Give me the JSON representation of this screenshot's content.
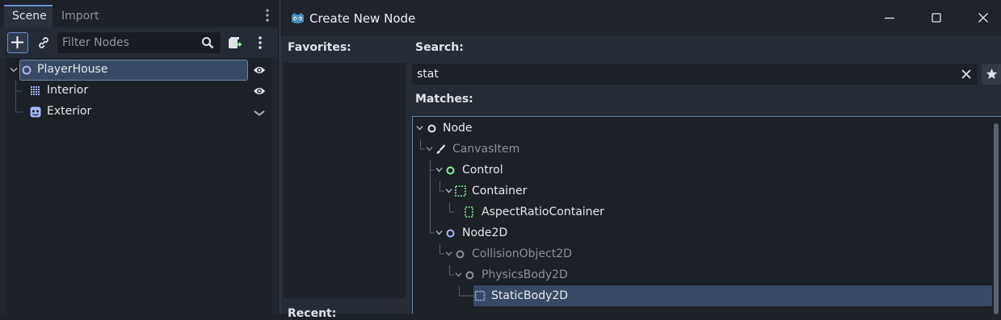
{
  "scene_dock": {
    "tabs": [
      {
        "label": "Scene",
        "active": true
      },
      {
        "label": "Import",
        "active": false
      }
    ],
    "filter": {
      "placeholder": "Filter Nodes",
      "value": ""
    },
    "tree": [
      {
        "label": "PlayerHouse",
        "icon": "node2d-icon",
        "selected": true,
        "visibility": "eye-icon"
      },
      {
        "label": "Interior",
        "icon": "tilemap-icon",
        "selected": false,
        "visibility": "eye-icon"
      },
      {
        "label": "Exterior",
        "icon": "sprite-icon",
        "selected": false,
        "visibility": "chevron-down-icon"
      }
    ]
  },
  "dialog": {
    "title": "Create New Node",
    "favorites_label": "Favorites:",
    "recent_label": "Recent:",
    "search_label": "Search:",
    "search_value": "stat",
    "matches_label": "Matches:",
    "matches": [
      {
        "label": "Node",
        "icon": "node-icon",
        "dim": false,
        "selected": false
      },
      {
        "label": "CanvasItem",
        "icon": "brush-icon",
        "dim": true,
        "selected": false
      },
      {
        "label": "Control",
        "icon": "control-icon",
        "dim": false,
        "selected": false
      },
      {
        "label": "Container",
        "icon": "container-icon",
        "dim": false,
        "selected": false
      },
      {
        "label": "AspectRatioContainer",
        "icon": "aspect-ratio-container-icon",
        "dim": false,
        "selected": false
      },
      {
        "label": "Node2D",
        "icon": "node2d-icon",
        "dim": false,
        "selected": false
      },
      {
        "label": "CollisionObject2D",
        "icon": "collision-object-2d-icon",
        "dim": true,
        "selected": false
      },
      {
        "label": "PhysicsBody2D",
        "icon": "physics-body-2d-icon",
        "dim": true,
        "selected": false
      },
      {
        "label": "StaticBody2D",
        "icon": "static-body-2d-icon",
        "dim": false,
        "selected": true
      }
    ]
  },
  "colors": {
    "accent": "#6a8fd1",
    "selection": "#384a63",
    "control_green": "#8eef97",
    "node2d_blue": "#a5b7f3"
  }
}
